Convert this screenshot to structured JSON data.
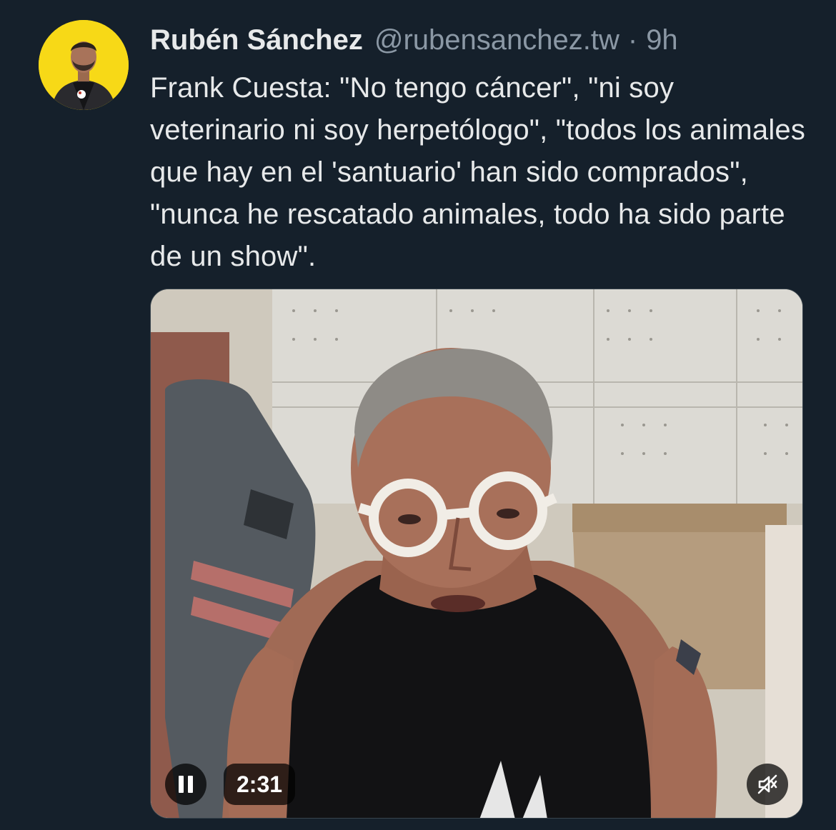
{
  "tweet": {
    "author": {
      "display_name": "Rubén Sánchez",
      "handle": "@rubensanchez.tw",
      "separator": "·",
      "time": "9h",
      "avatar_color": "#f7d917"
    },
    "text": "Frank Cuesta: \"No tengo cáncer\", \"ni soy veterinario ni soy herpetólogo\", \"todos los animales que hay en el 'santuario' han sido comprados\", \"nunca he rescatado animales, todo ha sido parte de un show\".",
    "media": {
      "type": "video",
      "duration": "2:31",
      "state": "playing",
      "muted": true,
      "controls": {
        "pause_icon": "pause-icon",
        "mute_icon": "speaker-muted-icon"
      }
    }
  },
  "colors": {
    "background": "#15202b",
    "primary_text": "#e7e9ea",
    "secondary_text": "#8b98a5"
  }
}
